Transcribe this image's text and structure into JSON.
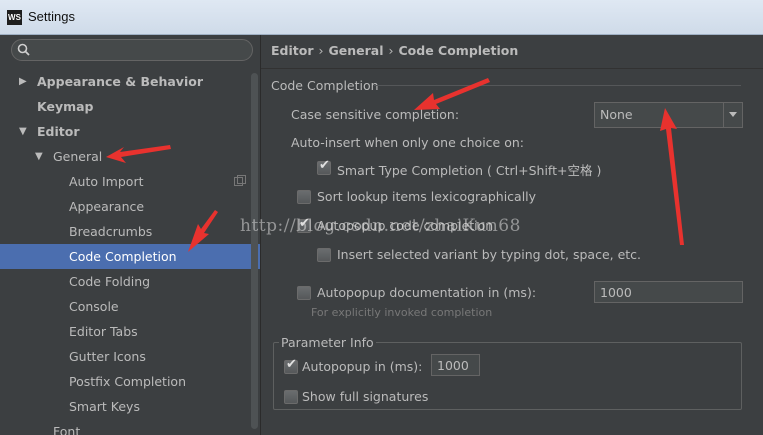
{
  "window": {
    "title": "Settings",
    "app_icon": "WS"
  },
  "search": {
    "placeholder": ""
  },
  "tree": {
    "items": [
      {
        "label": "Appearance & Behavior"
      },
      {
        "label": "Keymap"
      },
      {
        "label": "Editor"
      },
      {
        "label": "General"
      },
      {
        "label": "Auto Import"
      },
      {
        "label": "Appearance"
      },
      {
        "label": "Breadcrumbs"
      },
      {
        "label": "Code Completion"
      },
      {
        "label": "Code Folding"
      },
      {
        "label": "Console"
      },
      {
        "label": "Editor Tabs"
      },
      {
        "label": "Gutter Icons"
      },
      {
        "label": "Postfix Completion"
      },
      {
        "label": "Smart Keys"
      },
      {
        "label": "Font"
      }
    ],
    "selected": "Code Completion"
  },
  "breadcrumb": {
    "items": [
      "Editor",
      "General",
      "Code Completion"
    ],
    "separator": "›"
  },
  "code_completion": {
    "section_title": "Code Completion",
    "case_sensitive_label": "Case sensitive completion:",
    "case_sensitive_value": "None",
    "auto_insert_label": "Auto-insert when only one choice on:",
    "smart_type_label": "Smart Type Completion ( Ctrl+Shift+空格 )",
    "smart_type_checked": true,
    "sort_lookup_label": "Sort lookup items lexicographically",
    "sort_lookup_checked": false,
    "autopopup_code_label": "Autopopup code completion",
    "autopopup_code_checked": true,
    "insert_selected_label": "Insert selected variant by typing dot, space, etc.",
    "insert_selected_checked": false,
    "autopopup_doc_label": "Autopopup documentation in (ms):",
    "autopopup_doc_checked": false,
    "autopopup_doc_value": "1000",
    "autopopup_doc_hint": "For explicitly invoked completion"
  },
  "parameter_info": {
    "title": "Parameter Info",
    "autopopup_label": "Autopopup in (ms):",
    "autopopup_checked": true,
    "autopopup_value": "1000",
    "show_full_label": "Show full signatures",
    "show_full_checked": false
  },
  "watermark": "http://blog.csdn.net/zhaiKun68",
  "colors": {
    "background": "#3c3f41",
    "selection": "#4b6eaf",
    "text": "#bbbbbb",
    "annotation_arrow": "#e8322e"
  }
}
